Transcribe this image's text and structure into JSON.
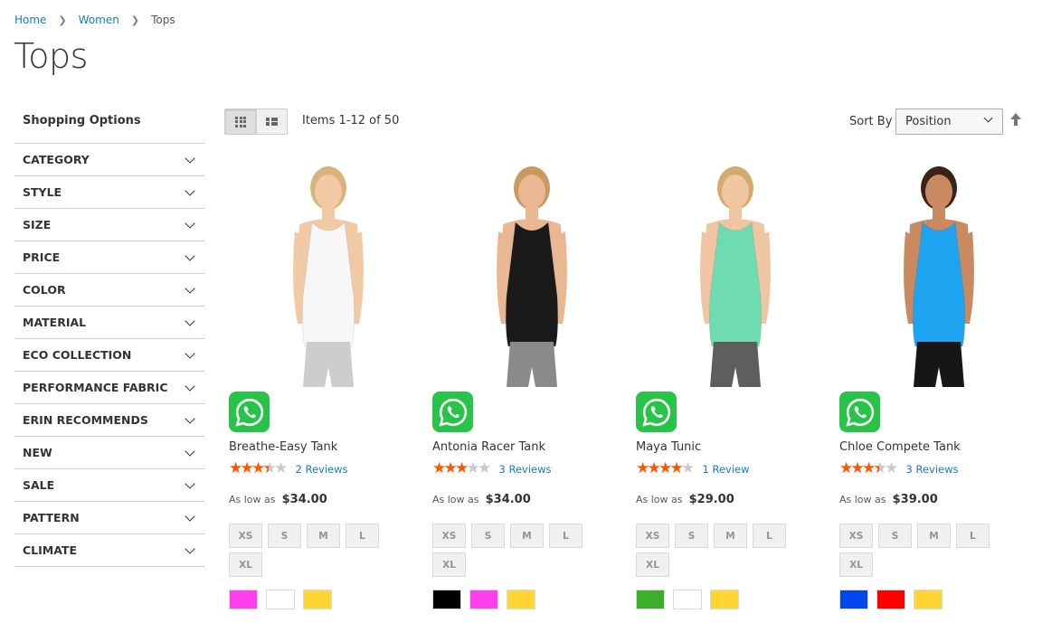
{
  "breadcrumb": {
    "home": "Home",
    "women": "Women",
    "current": "Tops"
  },
  "page_title": "Tops",
  "sidebar": {
    "title": "Shopping Options",
    "filters": [
      "CATEGORY",
      "STYLE",
      "SIZE",
      "PRICE",
      "COLOR",
      "MATERIAL",
      "ECO COLLECTION",
      "PERFORMANCE FABRIC",
      "ERIN RECOMMENDS",
      "NEW",
      "SALE",
      "PATTERN",
      "CLIMATE"
    ]
  },
  "toolbar": {
    "amount": "Items 1-12 of 50",
    "sort_label": "Sort By",
    "sort_value": "Position",
    "view_mode": "grid"
  },
  "products": [
    {
      "name": "Breathe-Easy Tank",
      "rating": 3.5,
      "reviews": "2 Reviews",
      "price_label": "As low as",
      "price": "$34.00",
      "sizes": [
        "XS",
        "S",
        "M",
        "L",
        "XL"
      ],
      "colors": [
        "#ff3ef0",
        "#ffffff",
        "#ffd435"
      ],
      "garment": {
        "top": "#f7f7f7",
        "bottom": "#cdcdcd",
        "skin": "#f2c9a5",
        "hair": "#d9b37a"
      }
    },
    {
      "name": "Antonia Racer Tank",
      "rating": 3,
      "reviews": "3 Reviews",
      "price_label": "As low as",
      "price": "$34.00",
      "sizes": [
        "XS",
        "S",
        "M",
        "L",
        "XL"
      ],
      "colors": [
        "#000000",
        "#ff3ef0",
        "#ffd435"
      ],
      "garment": {
        "top": "#1a1a1a",
        "bottom": "#8a8a8a",
        "skin": "#e9b892",
        "hair": "#c99a5c"
      }
    },
    {
      "name": "Maya Tunic",
      "rating": 4,
      "reviews": "1 Review",
      "price_label": "As low as",
      "price": "$29.00",
      "sizes": [
        "XS",
        "S",
        "M",
        "L",
        "XL"
      ],
      "colors": [
        "#3cae2c",
        "#ffffff",
        "#ffd435"
      ],
      "garment": {
        "top": "#6fdbb0",
        "bottom": "#5e5e5e",
        "skin": "#f0c5a2",
        "hair": "#d4aa6e"
      }
    },
    {
      "name": "Chloe Compete Tank",
      "rating": 3.5,
      "reviews": "3 Reviews",
      "price_label": "As low as",
      "price": "$39.00",
      "sizes": [
        "XS",
        "S",
        "M",
        "L",
        "XL"
      ],
      "colors": [
        "#0047f0",
        "#ff0000",
        "#ffd435"
      ],
      "garment": {
        "top": "#1ea3f0",
        "bottom": "#161616",
        "skin": "#c98a62",
        "hair": "#3a2216"
      }
    }
  ]
}
